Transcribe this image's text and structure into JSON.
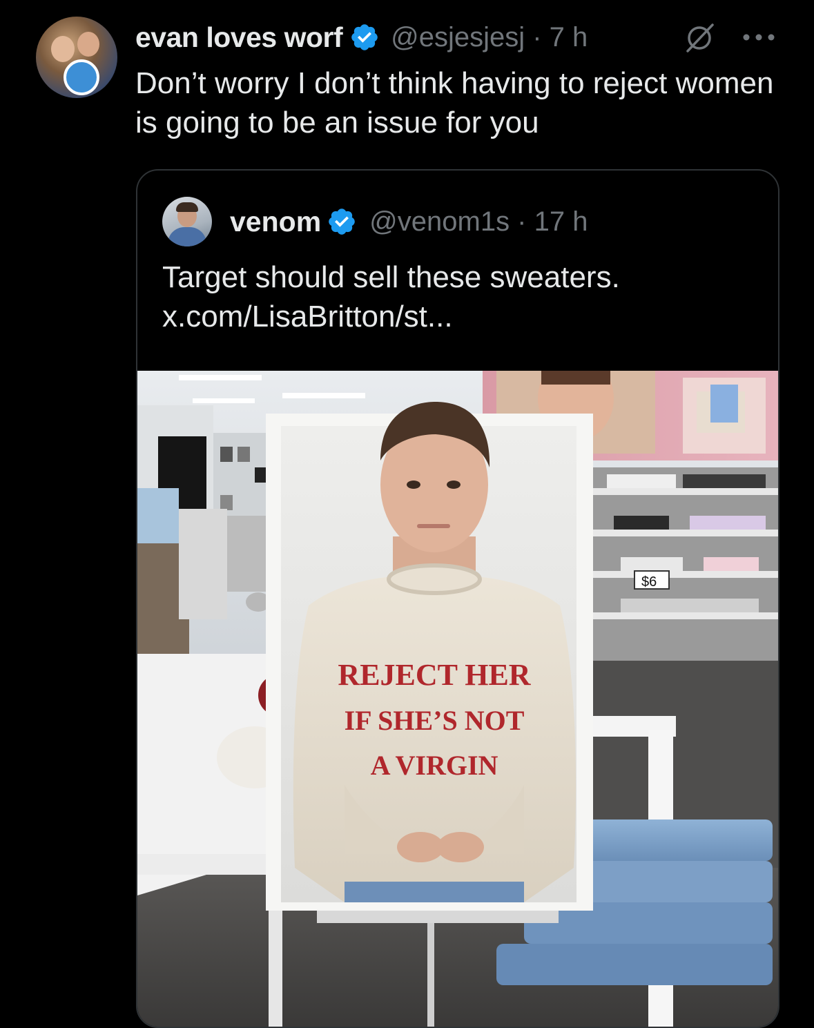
{
  "tweet": {
    "display_name": "evan loves worf",
    "handle_meta": "@esjesjesj · 7 h",
    "text": "Don’t worry I don’t think having to reject women is going to be an issue for you",
    "icons": {
      "verified": "verified-badge-icon",
      "grok": "grok-icon",
      "more": "more-options-icon",
      "avatar": "avatar"
    }
  },
  "quote": {
    "display_name": "venom",
    "handle_meta": "@venom1s · 17 h",
    "text_line1": "Target should sell these sweaters.",
    "link": "x.com/LisaBritton/st...",
    "image": {
      "sign_text_line1": "REJECT HER",
      "sign_text_line2": "IF SHE’S NOT",
      "sign_text_line3": "A VIRGIN",
      "price_tag": "$6"
    }
  },
  "colors": {
    "background": "#000000",
    "text_primary": "#e7e9ea",
    "text_secondary": "#71767b",
    "verified_blue": "#1d9bf0",
    "border": "#2f3336",
    "sweater_lettering": "#b0272c"
  }
}
